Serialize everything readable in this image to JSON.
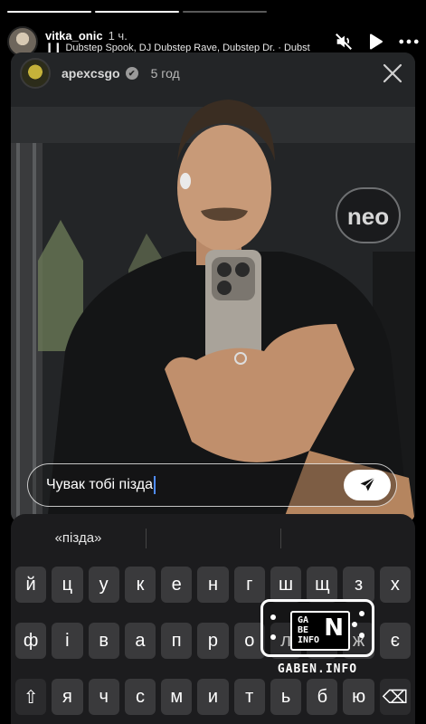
{
  "story": {
    "progress_segments": [
      1,
      1,
      0
    ],
    "username": "vitka_onic",
    "time": "1 ч.",
    "music_line": "Dubstep Spook, DJ Dubstep Rave, Dubstep Dr. · Dubst",
    "music_bars": "❙❙"
  },
  "inner": {
    "username": "apexcsgo",
    "verified_mark": "✔",
    "ago": "5 год"
  },
  "reply": {
    "text": "Чувак тобі пізда"
  },
  "keyboard": {
    "suggestions": [
      "«пізда»",
      "",
      ""
    ],
    "row1": [
      "й",
      "ц",
      "у",
      "к",
      "е",
      "н",
      "г",
      "ш",
      "щ",
      "з",
      "х"
    ],
    "row2": [
      "ф",
      "і",
      "в",
      "а",
      "п",
      "р",
      "о",
      "л",
      "д",
      "ж",
      "є"
    ],
    "row3": [
      "⇧",
      "я",
      "ч",
      "с",
      "м",
      "и",
      "т",
      "ь",
      "б",
      "ю",
      "⌫"
    ]
  },
  "watermark": {
    "line1": "GA",
    "line2": "BE",
    "line3": "INFO",
    "big": "N",
    "label": "GABEN.INFO"
  },
  "icons": {
    "mute": "mute-icon",
    "play": "play-icon",
    "more": "more-icon",
    "close": "close-icon",
    "send": "send-icon"
  }
}
